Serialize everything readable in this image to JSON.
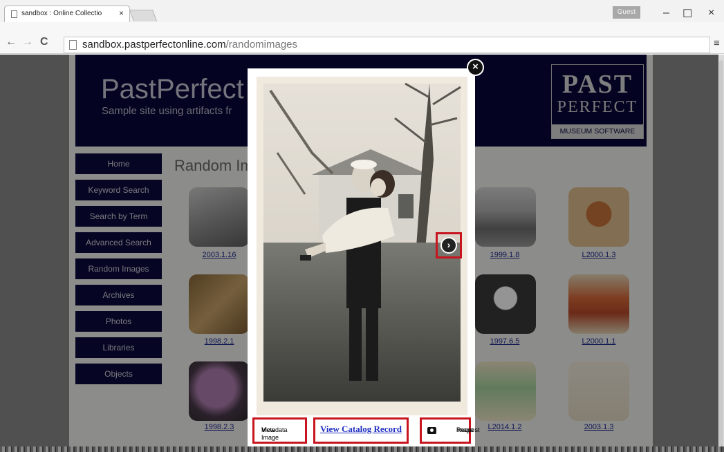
{
  "browser": {
    "tab_title": "sandbox : Online Collectio",
    "tab_close": "×",
    "profile_badge": "Guest",
    "url_host": "sandbox.pastperfectonline.com",
    "url_path": "/randomimages",
    "back": "←",
    "forward": "→",
    "reload": "C",
    "minimize": "–",
    "maximize": "☐",
    "close": "×",
    "menu": "≡"
  },
  "site": {
    "title": "PastPerfect M",
    "subtitle": "Sample site using artifacts fr",
    "logo_line1": "PAST",
    "logo_line2": "PERFECT",
    "logo_line3": "MUSEUM SOFTWARE",
    "section_title": "Random Ima",
    "nav": [
      "Home",
      "Keyword Search",
      "Search by Term",
      "Advanced Search",
      "Random Images",
      "Archives",
      "Photos",
      "Libraries",
      "Objects"
    ]
  },
  "gallery": [
    {
      "caption": "2003.1.16",
      "icon": "photo"
    },
    {
      "caption": "1999.1.8",
      "icon": "trees"
    },
    {
      "caption": "L2000.1.3",
      "icon": "horse"
    },
    {
      "caption": "1998.2.1",
      "icon": "fossil"
    },
    {
      "caption": "1997.6.5",
      "icon": "crystal"
    },
    {
      "caption": "L2000.1.1",
      "icon": "toy"
    },
    {
      "caption": "1998.2.3",
      "icon": "mineral"
    },
    {
      "caption": "L2014.1.2",
      "icon": "box"
    },
    {
      "caption": "2003.1.3",
      "icon": "letter"
    }
  ],
  "lightbox": {
    "close_icon": "close-icon",
    "next_icon": "chevron-right-icon",
    "metadata_line1": "View Image",
    "metadata_line2": "Metadata",
    "catalog_link": "View Catalog Record",
    "request_line1": "Request",
    "request_line2": "Image"
  },
  "colors": {
    "banner": "#08083c",
    "nav_button": "#0c0c3e",
    "highlight": "#c8141e",
    "link": "#1f2a8f"
  }
}
